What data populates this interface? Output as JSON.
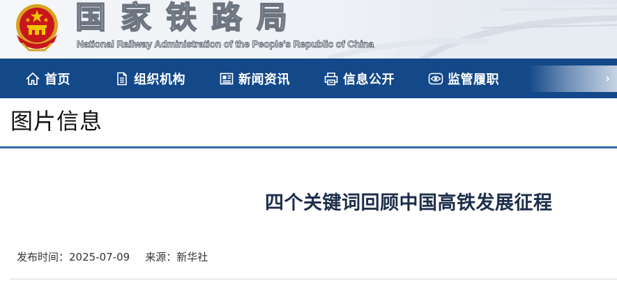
{
  "header": {
    "title": "国家铁路局",
    "subtitle": "National Railway Administration of the People's Republic of China"
  },
  "nav": {
    "items": [
      {
        "label": "首页",
        "icon": "home-icon"
      },
      {
        "label": "组织机构",
        "icon": "document-icon"
      },
      {
        "label": "新闻资讯",
        "icon": "newspaper-icon"
      },
      {
        "label": "信息公开",
        "icon": "printer-icon"
      },
      {
        "label": "监管履职",
        "icon": "eye-icon"
      }
    ]
  },
  "section": {
    "title": "图片信息"
  },
  "article": {
    "title": "四个关键词回顾中国高铁发展征程",
    "meta": {
      "date_label": "发布时间：",
      "date": "2025-07-09",
      "source_label": "来源：",
      "source": "新华社"
    }
  },
  "colors": {
    "nav_bg": "#134889",
    "rule": "#2f6aa6",
    "article_title": "#1d2e4b"
  }
}
